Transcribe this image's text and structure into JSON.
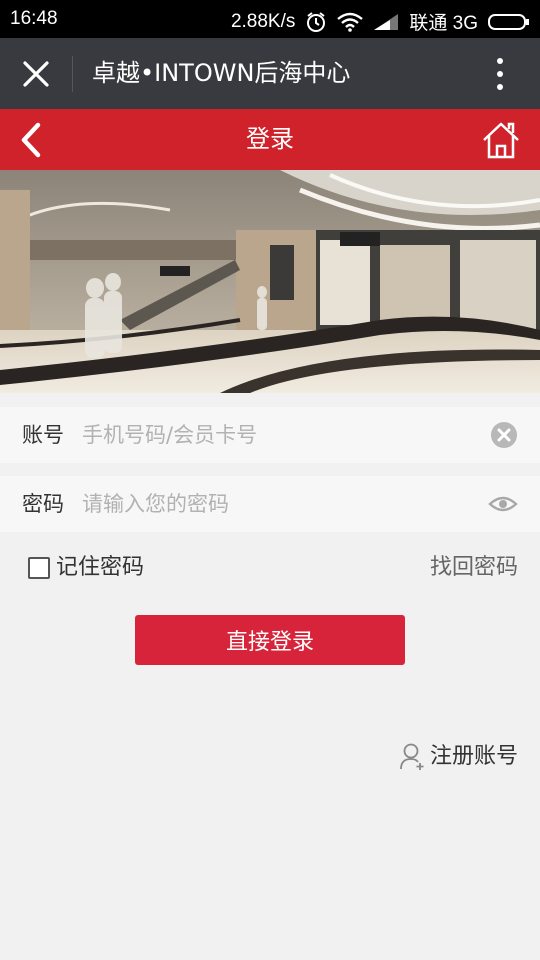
{
  "status_bar": {
    "time": "16:48",
    "speed": "2.88K/s",
    "carrier": "联通 3G"
  },
  "wx_header": {
    "title": "卓越•INTOWN后海中心",
    "close_icon": "close-icon",
    "more_icon": "more-vertical-icon"
  },
  "app_bar": {
    "title": "登录",
    "back_icon": "chevron-left-icon",
    "home_icon": "home-icon",
    "color": "#d0222b"
  },
  "form": {
    "account_label": "账号",
    "account_placeholder": "手机号码/会员卡号",
    "account_value": "",
    "password_label": "密码",
    "password_placeholder": "请输入您的密码",
    "password_value": "",
    "remember_label": "记住密码",
    "remember_checked": false,
    "forgot_label": "找回密码",
    "login_label": "直接登录",
    "register_label": "注册账号"
  },
  "colors": {
    "accent": "#d8243a",
    "background": "#f1f1f1"
  }
}
